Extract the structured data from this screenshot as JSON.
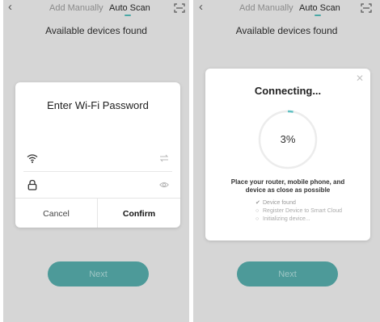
{
  "left": {
    "nav": {
      "back_icon": "chevron-left-icon",
      "tab_manual": "Add Manually",
      "tab_auto": "Auto Scan",
      "scan_icon": "scan-icon"
    },
    "subtitle": "Available devices found",
    "dialog": {
      "title": "Enter Wi-Fi Password",
      "ssid_value": "",
      "password_value": "",
      "cancel_label": "Cancel",
      "confirm_label": "Confirm"
    },
    "next_label": "Next"
  },
  "right": {
    "nav": {
      "back_icon": "chevron-left-icon",
      "tab_manual": "Add Manually",
      "tab_auto": "Auto Scan",
      "scan_icon": "scan-icon"
    },
    "subtitle": "Available devices found",
    "dialog": {
      "title": "Connecting...",
      "progress_text": "3%",
      "progress_fraction": 0.03,
      "hint_line1": "Place your router, mobile phone, and",
      "hint_line2": "device as close as possible",
      "steps": [
        {
          "mark": "✔",
          "label": "Device found",
          "done": true
        },
        {
          "mark": "○",
          "label": "Register Device to Smart Cloud",
          "done": false
        },
        {
          "mark": "○",
          "label": "Initializing device...",
          "done": false
        }
      ]
    },
    "next_label": "Next"
  },
  "colors": {
    "accent": "#4aa8a5",
    "button": "#4d9a99",
    "overlay": "#d6d6d6"
  }
}
